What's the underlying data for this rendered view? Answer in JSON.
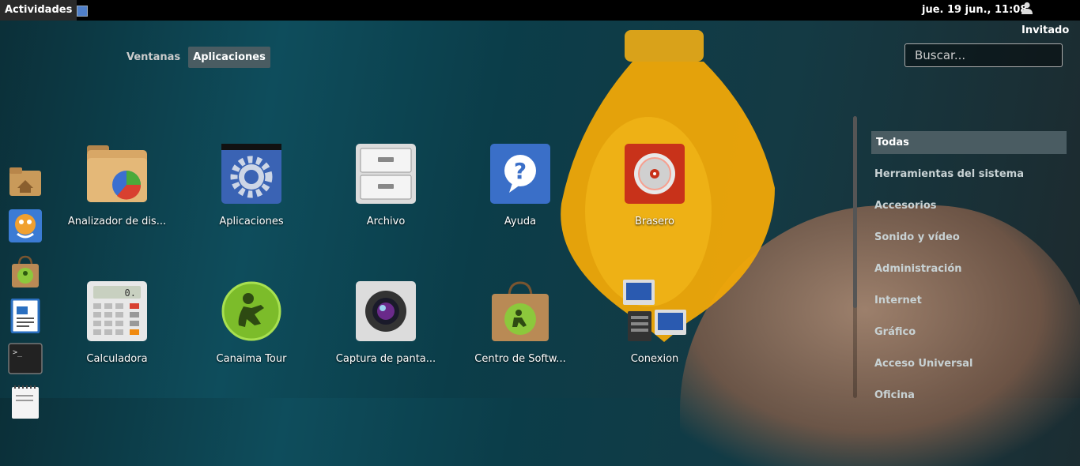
{
  "topbar": {
    "activities_label": "Actividades",
    "clock": "jue. 19 jun., 11:08",
    "user": "Invitado"
  },
  "view_tabs": [
    {
      "label": "Ventanas",
      "active": false
    },
    {
      "label": "Aplicaciones",
      "active": true
    }
  ],
  "search": {
    "placeholder": "Buscar...",
    "value": ""
  },
  "dash": [
    "home-folder-icon",
    "tux-paint-icon",
    "software-center-icon",
    "writer-document-icon",
    "terminal-icon",
    "text-editor-icon"
  ],
  "apps": [
    {
      "label": "Analizador de dis...",
      "icon": "disk-usage-icon"
    },
    {
      "label": "Aplicaciones",
      "icon": "settings-gear-icon"
    },
    {
      "label": "Archivo",
      "icon": "file-cabinet-icon"
    },
    {
      "label": "Ayuda",
      "icon": "help-icon"
    },
    {
      "label": "Brasero",
      "icon": "disc-burner-icon"
    },
    {
      "label": "Calculadora",
      "icon": "calculator-icon"
    },
    {
      "label": "Canaima Tour",
      "icon": "canaima-tour-icon"
    },
    {
      "label": "Captura de panta...",
      "icon": "camera-icon"
    },
    {
      "label": "Centro de Softw...",
      "icon": "shopping-bag-icon"
    },
    {
      "label": "Conexion",
      "icon": "remote-desktop-icon"
    }
  ],
  "categories": [
    {
      "label": "Todas",
      "active": true
    },
    {
      "label": "Herramientas del sistema",
      "active": false
    },
    {
      "label": "Accesorios",
      "active": false
    },
    {
      "label": "Sonido y vídeo",
      "active": false
    },
    {
      "label": "Administración",
      "active": false
    },
    {
      "label": "Internet",
      "active": false
    },
    {
      "label": "Gráfico",
      "active": false
    },
    {
      "label": "Acceso Universal",
      "active": false
    },
    {
      "label": "Oficina",
      "active": false
    }
  ],
  "colors": {
    "accent": "#4a5c62",
    "topbar": "#000000",
    "background": "#0e4d5c"
  }
}
